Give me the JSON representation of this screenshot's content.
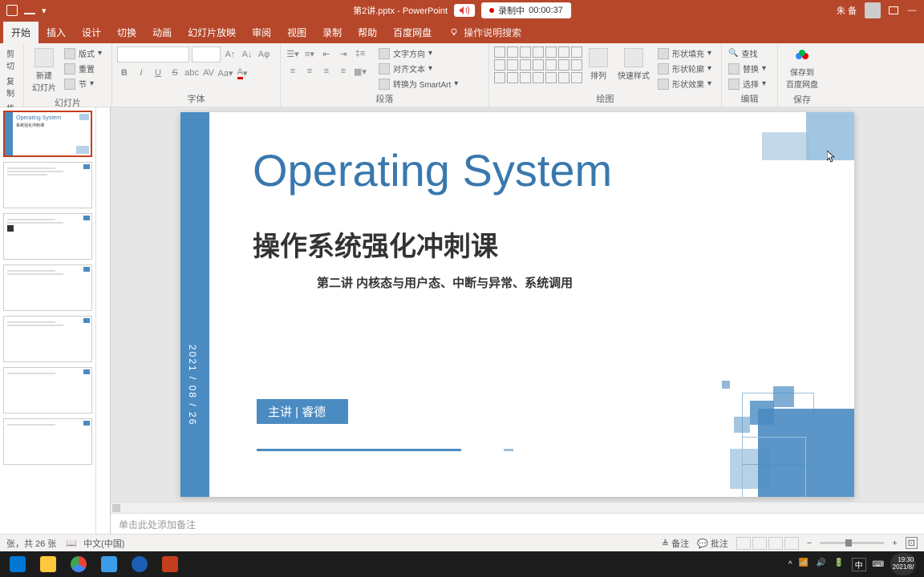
{
  "titlebar": {
    "filename": "第2讲.pptx",
    "app": "PowerPoint",
    "recording_label": "录制中",
    "recording_time": "00:00:37",
    "username": "朱 备"
  },
  "tabs": {
    "start": "开始",
    "insert": "插入",
    "design": "设计",
    "transition": "切换",
    "animation": "动画",
    "slideshow": "幻灯片放映",
    "review": "审阅",
    "view": "视图",
    "record": "录制",
    "help": "帮助",
    "baidu": "百度网盘",
    "tellme": "操作说明搜索"
  },
  "ribbon": {
    "clipboard": {
      "cut": "剪切",
      "copy": "复制",
      "painter": "格式刷"
    },
    "slides": {
      "new": "新建\n幻灯片",
      "layout": "版式",
      "reset": "重置",
      "section": "节",
      "label": "幻灯片"
    },
    "font": {
      "label": "字体",
      "bold": "B",
      "italic": "I",
      "underline": "U",
      "strike": "S",
      "shadow": "abc"
    },
    "paragraph": {
      "label": "段落",
      "textdir": "文字方向",
      "align": "对齐文本",
      "smartart": "转换为 SmartArt"
    },
    "drawing": {
      "label": "绘图",
      "arrange": "排列",
      "quickstyle": "快速样式",
      "fill": "形状填充",
      "outline": "形状轮廓",
      "effects": "形状效果"
    },
    "editing": {
      "label": "编辑",
      "find": "查找",
      "replace": "替换",
      "select": "选择"
    },
    "save": {
      "label": "保存",
      "saveto": "保存到\n百度网盘"
    }
  },
  "slide": {
    "title": "Operating System",
    "subtitle": "操作系统强化冲刺课",
    "lecture": "第二讲 内核态与用户态、中断与异常、系统调用",
    "lecturer": "主讲 | 睿德",
    "date": "2021 / 08 / 26"
  },
  "thumbs": {
    "t1": "Operating System",
    "t1sub": "系统强化冲刺课"
  },
  "notes_placeholder": "单击此处添加备注",
  "status": {
    "slide_count": "张，共 26 张",
    "lang": "中文(中国)",
    "notes": "备注",
    "comments": "批注"
  },
  "taskbar": {
    "ime": "中",
    "time": "19:30",
    "date": "2021/8/"
  }
}
